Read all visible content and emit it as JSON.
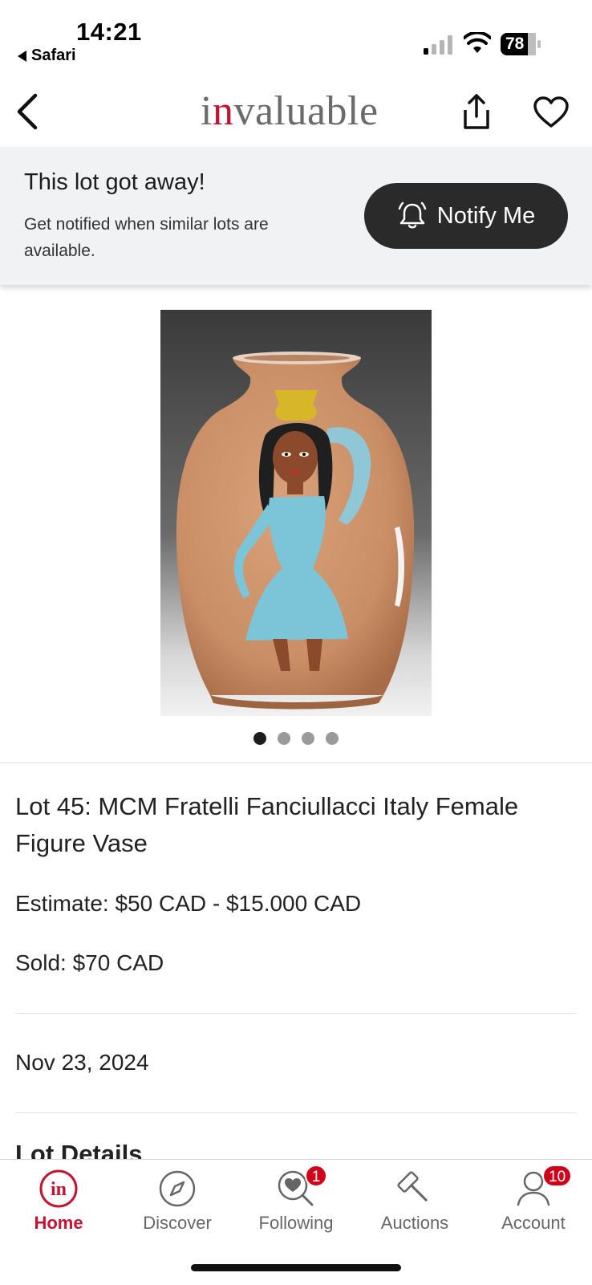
{
  "status_bar": {
    "time": "14:21",
    "back_app": "Safari",
    "battery": "78"
  },
  "header": {
    "logo_first": "i",
    "logo_red": "n",
    "logo_rest": "valuable"
  },
  "banner": {
    "title": "This lot got away!",
    "text": "Get notified when similar lots are available.",
    "button_label": "Notify Me"
  },
  "gallery": {
    "count": 4,
    "active_index": 0
  },
  "lot": {
    "title": "Lot 45: MCM Fratelli Fanciullacci Italy Female Figure Vase",
    "estimate": "Estimate: $50 CAD - $15.000 CAD",
    "sold": "Sold: $70 CAD",
    "date": "Nov 23, 2024",
    "details_heading": "Lot Details"
  },
  "tabs": [
    {
      "label": "Home",
      "icon": "home-logo-icon",
      "badge": ""
    },
    {
      "label": "Discover",
      "icon": "compass-icon",
      "badge": ""
    },
    {
      "label": "Following",
      "icon": "heart-search-icon",
      "badge": "1"
    },
    {
      "label": "Auctions",
      "icon": "gavel-icon",
      "badge": ""
    },
    {
      "label": "Account",
      "icon": "person-icon",
      "badge": "10"
    }
  ],
  "colors": {
    "brand_red": "#c41230",
    "badge_red": "#d0021b",
    "button_dark": "#2a2a2a",
    "banner_bg": "#f1f2f4"
  }
}
